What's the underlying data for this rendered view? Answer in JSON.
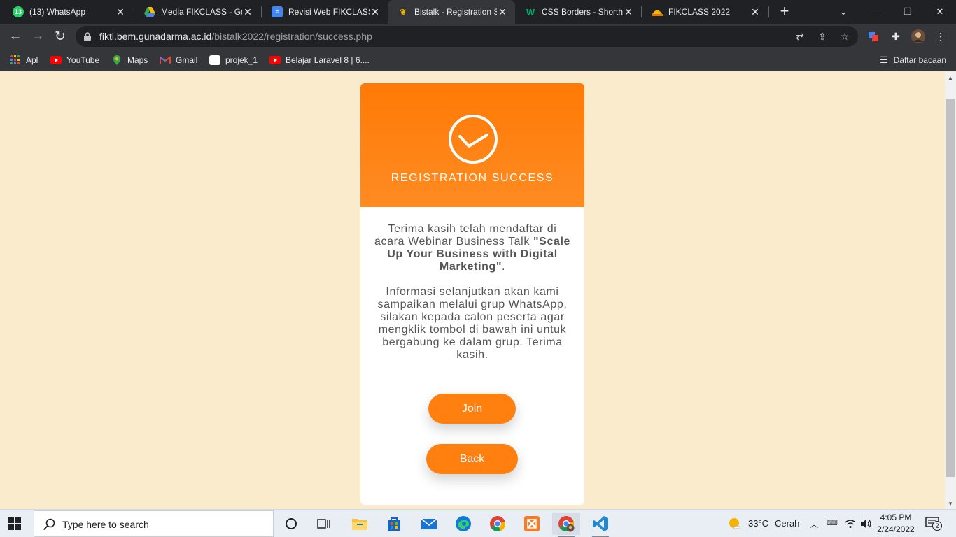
{
  "browser": {
    "tabs": [
      {
        "title": "(13) WhatsApp",
        "favicon": "whatsapp-icon",
        "badge": "13"
      },
      {
        "title": "Media FIKCLASS - Goo",
        "favicon": "google-drive-icon"
      },
      {
        "title": "Revisi Web FIKCLASS -",
        "favicon": "google-docs-icon"
      },
      {
        "title": "Bistalk - Registration S",
        "favicon": "bistalk-icon",
        "active": true
      },
      {
        "title": "CSS Borders - Shortha",
        "favicon": "w3schools-icon"
      },
      {
        "title": "FIKCLASS 2022",
        "favicon": "fikclass-icon"
      }
    ],
    "url_host": "fikti.bem.gunadarma.ac.id",
    "url_path": "/bistalk2022/registration/success.php",
    "bookmarks": [
      {
        "label": "Apl",
        "icon": "apps-grid-icon"
      },
      {
        "label": "YouTube",
        "icon": "youtube-icon"
      },
      {
        "label": "Maps",
        "icon": "maps-icon"
      },
      {
        "label": "Gmail",
        "icon": "gmail-icon"
      },
      {
        "label": "projek_1",
        "icon": "blank-page-icon"
      },
      {
        "label": "Belajar Laravel 8 | 6....",
        "icon": "youtube-icon"
      }
    ],
    "reading_list": "Daftar bacaan"
  },
  "page": {
    "heading": "REGISTRATION SUCCESS",
    "message_intro": "Terima kasih telah mendaftar di acara Webinar Business Talk ",
    "message_event": "\"Scale Up Your Business with Digital Marketing\"",
    "message_end": ".",
    "message_info": "Informasi selanjutkan akan kami sampaikan melalui grup WhatsApp, silakan kepada calon peserta agar mengklik tombol di bawah ini untuk bergabung ke dalam grup. Terima kasih.",
    "join_label": "Join",
    "back_label": "Back",
    "colors": {
      "accent": "#ff7f0f",
      "page_bg": "#faebcd"
    }
  },
  "taskbar": {
    "search_placeholder": "Type here to search",
    "weather_temp": "33°C",
    "weather_text": "Cerah",
    "time": "4:05 PM",
    "date": "2/24/2022",
    "notifications": "2"
  }
}
